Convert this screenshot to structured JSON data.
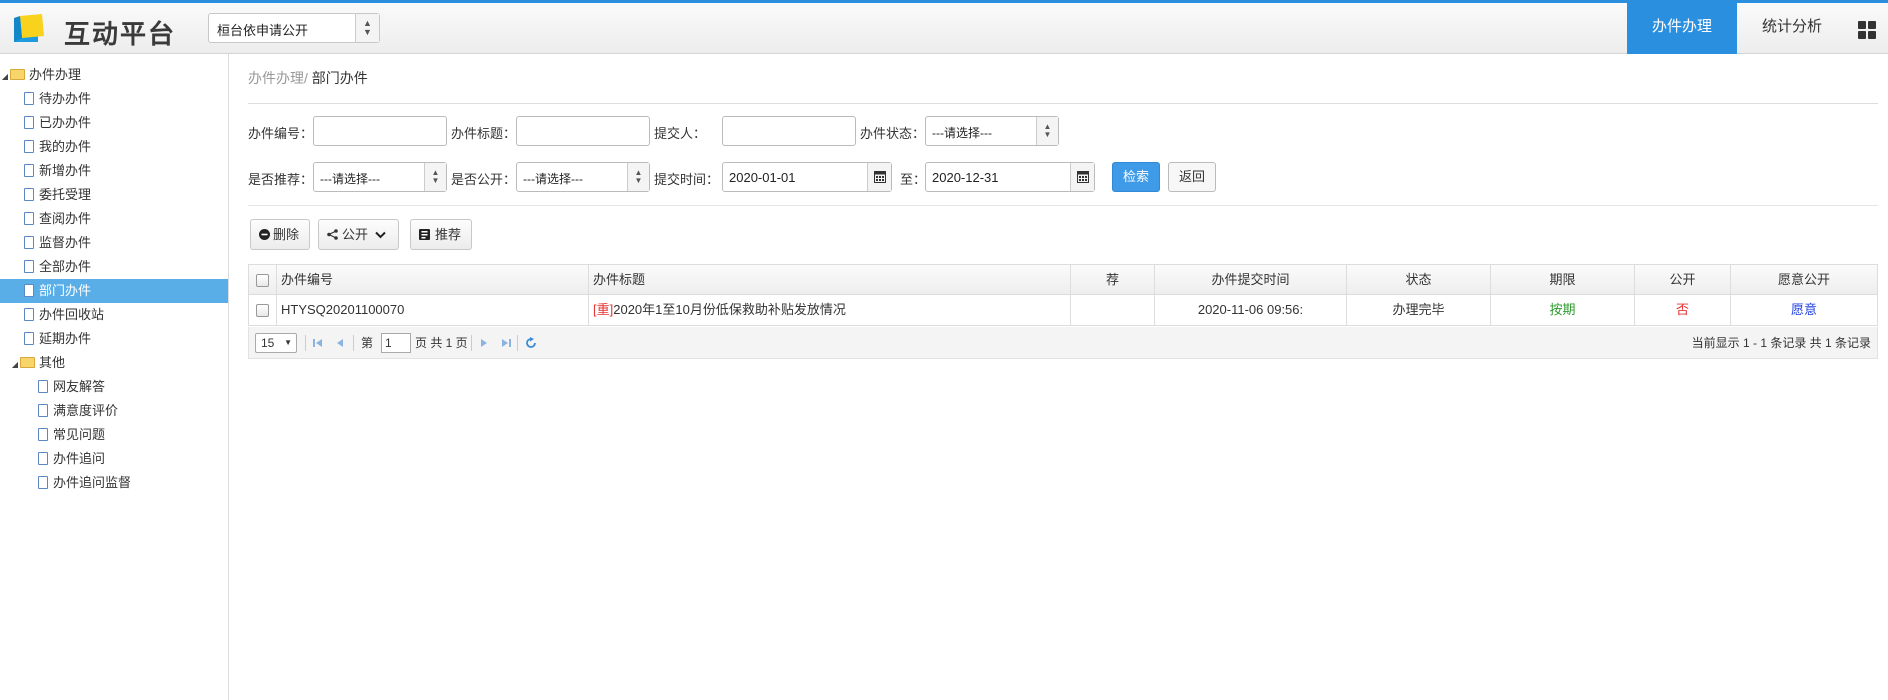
{
  "header": {
    "app_title": "互动平台",
    "site_select": "桓台依申请公开",
    "tabs": [
      {
        "label": "办件办理",
        "active": true
      },
      {
        "label": "统计分析",
        "active": false
      }
    ],
    "accent_color": "#2b8fe0"
  },
  "sidebar": {
    "groups": [
      {
        "label": "办件办理",
        "expanded": true,
        "items": [
          "待办办件",
          "已办办件",
          "我的办件",
          "新增办件",
          "委托受理",
          "查阅办件",
          "监督办件",
          "全部办件",
          "部门办件",
          "办件回收站",
          "延期办件"
        ]
      },
      {
        "label": "其他",
        "expanded": true,
        "items": [
          "网友解答",
          "满意度评价",
          "常见问题",
          "办件追问",
          "办件追问监督"
        ]
      }
    ],
    "selected": "部门办件"
  },
  "breadcrumb": {
    "parent": "办件办理/",
    "current": "部门办件"
  },
  "filters": {
    "case_no_label": "办件编号：",
    "case_no_value": "",
    "title_label": "办件标题：",
    "title_value": "",
    "submitter_label": "提交人：",
    "submitter_value": "",
    "status_label": "办件状态：",
    "status_value": "---请选择---",
    "recommend_label": "是否推荐：",
    "recommend_value": "---请选择---",
    "public_label": "是否公开：",
    "public_value": "---请选择---",
    "time_label": "提交时间：",
    "time_from": "2020-01-01",
    "to_label": "至：",
    "time_to": "2020-12-31",
    "search_button": "检索",
    "back_button": "返回"
  },
  "toolbar": {
    "delete": "删除",
    "publish": "公开",
    "recommend": "推荐"
  },
  "table": {
    "columns": [
      "办件编号",
      "办件标题",
      "荐",
      "办件提交时间",
      "状态",
      "期限",
      "公开",
      "愿意公开"
    ],
    "rows": [
      {
        "case_no": "HTYSQ20201100070",
        "tag": "[重]",
        "title": "2020年1至10月份低保救助补贴发放情况",
        "recommend": "",
        "submit_time": "2020-11-06 09:56:",
        "status": "办理完毕",
        "deadline": "按期",
        "public": "否",
        "willing": "愿意"
      }
    ]
  },
  "pager": {
    "page_size": "15",
    "page_prefix": "第",
    "page_value": "1",
    "page_suffix": "页 共 1 页",
    "summary": "当前显示 1 - 1 条记录 共 1 条记录"
  }
}
